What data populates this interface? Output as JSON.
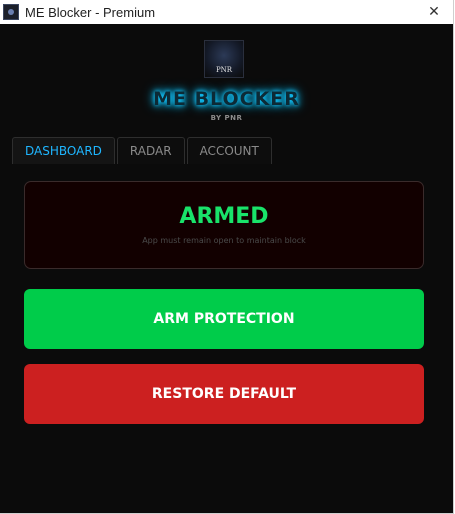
{
  "window": {
    "title": "ME Blocker - Premium",
    "close_glyph": "✕"
  },
  "brand": {
    "logo_text": "PNR",
    "title": "ME BLOCKER",
    "subtitle": "BY PNR"
  },
  "tabs": [
    {
      "label": "DASHBOARD",
      "active": true
    },
    {
      "label": "RADAR",
      "active": false
    },
    {
      "label": "ACCOUNT",
      "active": false
    }
  ],
  "status": {
    "title": "ARMED",
    "note": "App must remain open to maintain block"
  },
  "actions": {
    "arm_label": "ARM PROTECTION",
    "restore_label": "RESTORE DEFAULT"
  },
  "colors": {
    "accent_tab": "#1fb6ff",
    "armed_text": "#19e36a",
    "arm_button": "#00cc4a",
    "restore_button": "#cc2020",
    "brand_glow": "#12c8ff"
  }
}
